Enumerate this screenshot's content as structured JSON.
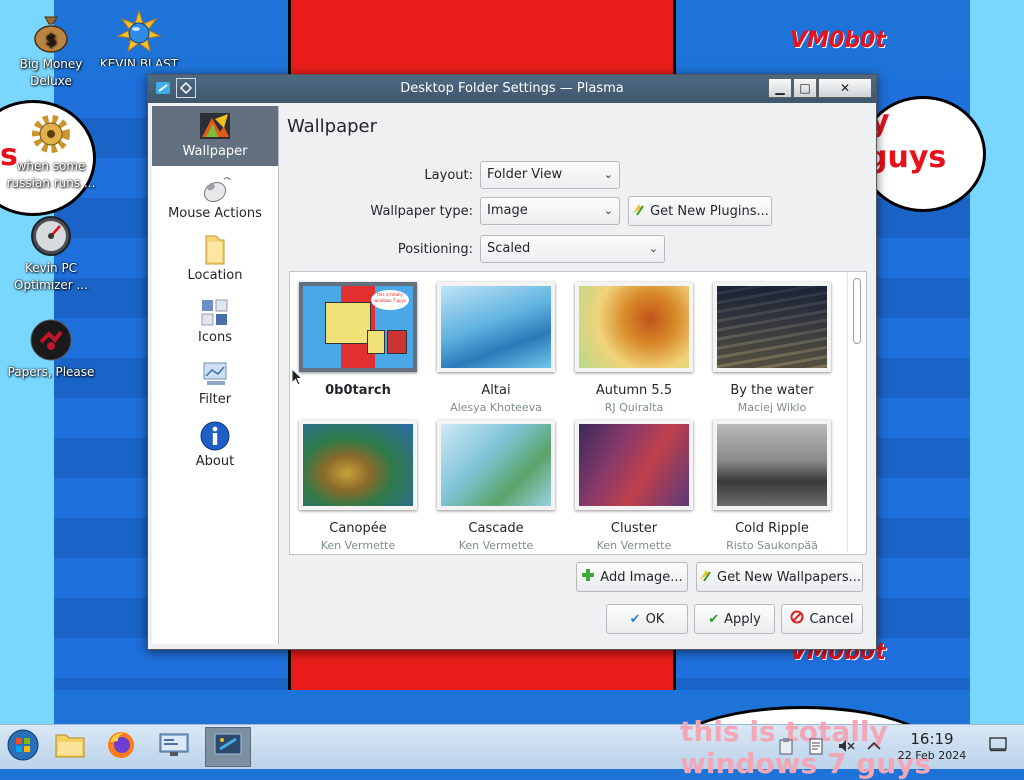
{
  "wallpaper": {
    "logo_top": "VM0b0t",
    "logo_bottom": "VM0b0t",
    "left_letter": "s",
    "right_text_top": "y",
    "right_text_bottom": "guys",
    "bottom_text_line1": "this is totally",
    "bottom_text_line2": "windows 7 guys"
  },
  "desktop": {
    "icons": [
      {
        "label": "Big Money Deluxe",
        "icon": "money-bag-icon"
      },
      {
        "label": "KEVIN BLAST",
        "icon": "starburst-globe-icon"
      },
      {
        "label": "when some russian runs ...",
        "icon": "gear-icon"
      },
      {
        "label": "Kevin PC Optimizer ...",
        "icon": "speedometer-icon"
      },
      {
        "label": "Papers, Please",
        "icon": "papers-please-icon"
      }
    ]
  },
  "dialog": {
    "title": "Desktop Folder Settings — Plasma",
    "window_buttons": {
      "minimize": "▁",
      "maximize": "□",
      "close": "✕"
    },
    "sidebar": [
      {
        "label": "Wallpaper",
        "icon": "wallpaper-icon",
        "selected": true
      },
      {
        "label": "Mouse Actions",
        "icon": "mouse-icon",
        "selected": false
      },
      {
        "label": "Location",
        "icon": "folder-icon",
        "selected": false
      },
      {
        "label": "Icons",
        "icon": "icons-icon",
        "selected": false
      },
      {
        "label": "Filter",
        "icon": "filter-icon",
        "selected": false
      },
      {
        "label": "About",
        "icon": "info-icon",
        "selected": false
      }
    ],
    "page_title": "Wallpaper",
    "layout": {
      "label": "Layout:",
      "value": "Folder View"
    },
    "wallpaper_type": {
      "label": "Wallpaper type:",
      "value": "Image"
    },
    "get_new_plugins": "Get New Plugins...",
    "positioning": {
      "label": "Positioning:",
      "value": "Scaled"
    },
    "wallpapers": [
      {
        "name": "0b0tarch",
        "author": "",
        "selected": true
      },
      {
        "name": "Altai",
        "author": "Alesya Khoteeva",
        "selected": false
      },
      {
        "name": "Autumn 5.5",
        "author": "RJ Quiralta",
        "selected": false
      },
      {
        "name": "By the water",
        "author": "Maciej Wiklo",
        "selected": false
      },
      {
        "name": "Canopée",
        "author": "Ken Vermette",
        "selected": false
      },
      {
        "name": "Cascade",
        "author": "Ken Vermette",
        "selected": false
      },
      {
        "name": "Cluster",
        "author": "Ken Vermette",
        "selected": false
      },
      {
        "name": "Cold Ripple",
        "author": "Risto Saukonpää",
        "selected": false
      }
    ],
    "thumb_text": "this is totally windows 7 guys",
    "add_image": "Add Image...",
    "get_new_wallpapers": "Get New Wallpapers...",
    "ok": "OK",
    "apply": "Apply",
    "cancel": "Cancel"
  },
  "taskbar": {
    "apps": [
      {
        "name": "start-button",
        "icon": "windows-orb-icon"
      },
      {
        "name": "file-manager",
        "icon": "folder-icon"
      },
      {
        "name": "firefox",
        "icon": "firefox-icon"
      },
      {
        "name": "system-settings",
        "icon": "monitor-settings-icon"
      },
      {
        "name": "desktop-settings-task",
        "icon": "plasma-settings-icon",
        "active": true
      }
    ],
    "tray": [
      "clipboard-icon",
      "notes-icon",
      "volume-muted-icon",
      "chevron-up-icon"
    ],
    "time": "16:19",
    "date": "22 Feb 2024"
  }
}
